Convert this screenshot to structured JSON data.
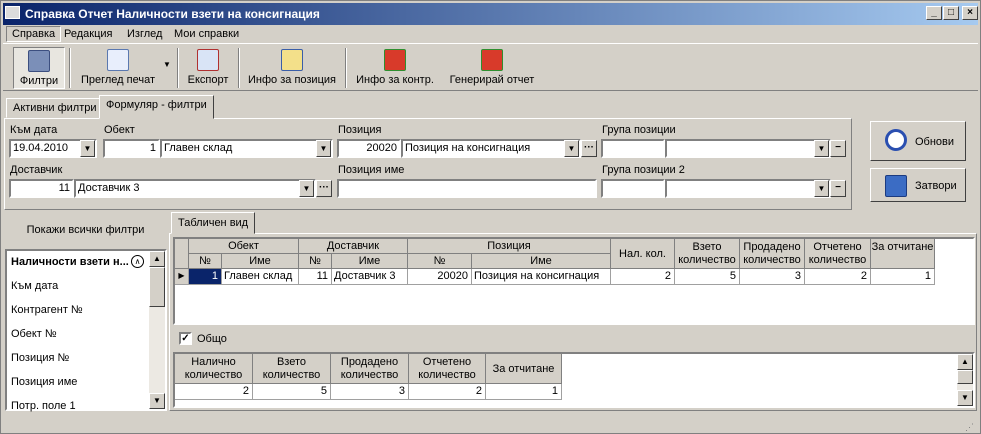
{
  "window": {
    "title": "Справка Отчет Наличности взети на консигнация",
    "min": "_",
    "max": "□",
    "close": "×"
  },
  "menu": [
    "Справка",
    "Редакция",
    "Изглед",
    "Мои справки"
  ],
  "toolbar": {
    "filters": "Филтри",
    "preview": "Преглед печат",
    "export": "Експорт",
    "item_info": "Инфо за позиция",
    "contr_info": "Инфо за контр.",
    "generate": "Генерирай отчет"
  },
  "tabs": {
    "active_filters": "Активни филтри",
    "form_filters": "Формуляр - филтри"
  },
  "form": {
    "to_date_label": "Към дата",
    "to_date": "19.04.2010",
    "object_label": "Обект",
    "object_no": "1",
    "object_name": "Главен склад",
    "position_label": "Позиция",
    "position_no": "20020",
    "position_name": "Позиция на консигнация",
    "group_label": "Група позиции",
    "group_no": "",
    "group_name": "",
    "supplier_label": "Доставчик",
    "supplier_no": "11",
    "supplier_name": "Доставчик 3",
    "position_name_label": "Позиция име",
    "position_name_value": "",
    "group2_label": "Група позиции 2",
    "group2_no": "",
    "group2_name": ""
  },
  "buttons": {
    "refresh": "Обнови",
    "close": "Затвори"
  },
  "side": {
    "show_all": "Покажи всички филтри",
    "items": [
      "Наличности взети н...",
      "Към дата",
      "Контрагент №",
      "Обект №",
      "Позиция №",
      "Позиция име",
      "Потр. поле 1"
    ]
  },
  "table_tab": "Табличен вид",
  "table": {
    "groups": {
      "object": "Обект",
      "supplier": "Доставчик",
      "position": "Позиция"
    },
    "sub": {
      "no": "№",
      "name": "Име"
    },
    "cols": {
      "avail": "Нал. кол.",
      "taken": "Взето количество",
      "sold": "Продадено количество",
      "reported": "Отчетено количество",
      "to_report": "За отчитане"
    },
    "rows": [
      {
        "obj_no": "1",
        "obj_name": "Главен склад",
        "sup_no": "11",
        "sup_name": "Доставчик 3",
        "pos_no": "20020",
        "pos_name": "Позиция на консигнация",
        "avail": "2",
        "taken": "5",
        "sold": "3",
        "reported": "2",
        "to_report": "1"
      }
    ]
  },
  "totals": {
    "checkbox_label": "Общо",
    "checked": true,
    "cols": {
      "avail": "Налично количество",
      "taken": "Взето количество",
      "sold": "Продадено количество",
      "reported": "Отчетено количество",
      "to_report": "За отчитане"
    },
    "values": {
      "avail": "2",
      "taken": "5",
      "sold": "3",
      "reported": "2",
      "to_report": "1"
    }
  },
  "colors": {
    "title_start": "#0a246a",
    "title_end": "#a6caf0",
    "face": "#d4d0c8"
  }
}
